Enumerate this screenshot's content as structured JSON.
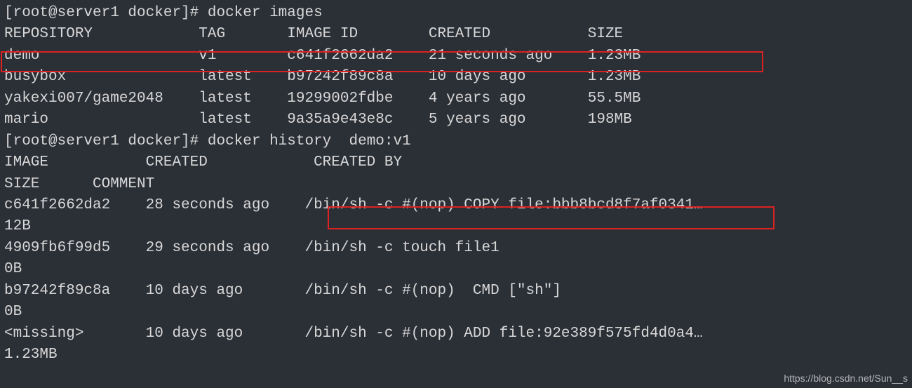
{
  "prompt1": {
    "prefix": "[root@server1 docker]# ",
    "command": "docker images"
  },
  "images_header": "REPOSITORY            TAG       IMAGE ID        CREATED           SIZE",
  "images_rows": [
    "demo                  v1        c641f2662da2    21 seconds ago    1.23MB",
    "busybox               latest    b97242f89c8a    10 days ago       1.23MB",
    "yakexi007/game2048    latest    19299002fdbe    4 years ago       55.5MB",
    "mario                 latest    9a35a9e43e8c    5 years ago       198MB"
  ],
  "prompt2": {
    "prefix": "[root@server1 docker]# ",
    "command": "docker history  demo:v1"
  },
  "history_header1": "IMAGE           CREATED            CREATED BY",
  "history_header2": "SIZE      COMMENT",
  "history_rows": [
    "c641f2662da2    28 seconds ago    /bin/sh -c #(nop) COPY file:bbb8bcd8f7af0341…",
    "12B",
    "4909fb6f99d5    29 seconds ago    /bin/sh -c touch file1",
    "0B",
    "b97242f89c8a    10 days ago       /bin/sh -c #(nop)  CMD [\"sh\"]",
    "0B",
    "<missing>       10 days ago       /bin/sh -c #(nop) ADD file:92e389f575fd4d0a4…",
    "1.23MB"
  ],
  "watermark": "https://blog.csdn.net/Sun__s"
}
